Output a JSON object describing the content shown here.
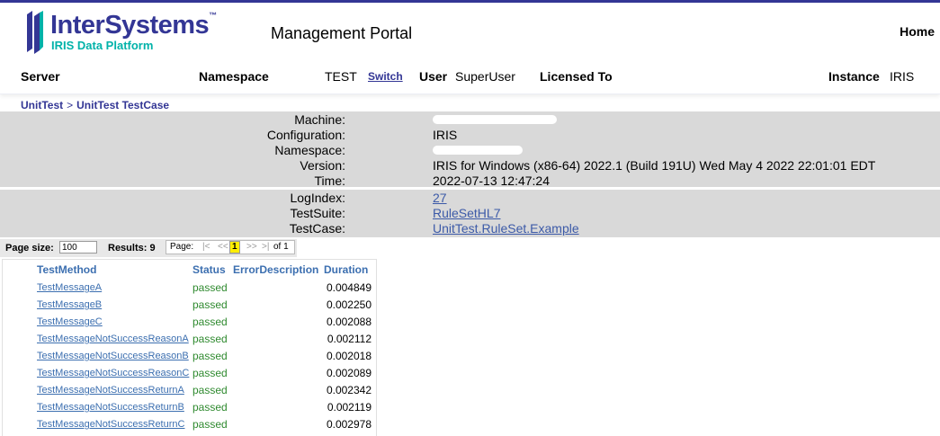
{
  "header": {
    "logo_name": "InterSystems",
    "logo_tm": "™",
    "logo_sub": "IRIS Data Platform",
    "title": "Management Portal",
    "home": "Home"
  },
  "info": {
    "server_label": "Server",
    "namespace_label": "Namespace",
    "namespace_value": "TEST",
    "switch_label": "Switch",
    "user_label": "User",
    "user_value": "SuperUser",
    "licensed_label": "Licensed To",
    "instance_label": "Instance",
    "instance_value": "IRIS"
  },
  "breadcrumb": {
    "items": [
      "UnitTest",
      "UnitTest TestCase"
    ],
    "separator": ">"
  },
  "details": {
    "machine_label": "Machine:",
    "configuration_label": "Configuration:",
    "configuration_value": "IRIS",
    "namespace_label": "Namespace:",
    "version_label": "Version:",
    "version_value": "IRIS for Windows (x86-64) 2022.1 (Build 191U) Wed May 4 2022 22:01:01 EDT",
    "time_label": "Time:",
    "time_value": "2022-07-13 12:47:24",
    "logindex_label": "LogIndex:",
    "logindex_value": "27",
    "testsuite_label": "TestSuite:",
    "testsuite_value": "RuleSetHL7",
    "testcase_label": "TestCase:",
    "testcase_value": "UnitTest.RuleSet.Example"
  },
  "table_nav": {
    "page_size_label": "Page size:",
    "page_size_value": "100",
    "results_label": "Results: 9",
    "page_label": "Page:",
    "first": "|<",
    "prev": "<<",
    "current_page": "1",
    "next": ">>",
    "last": ">|",
    "of_label": "of 1"
  },
  "table": {
    "columns": [
      "TestMethod",
      "Status",
      "ErrorDescription",
      "Duration"
    ],
    "rows": [
      {
        "method": "TestMessageA",
        "status": "passed",
        "error": "",
        "duration": "0.004849"
      },
      {
        "method": "TestMessageB",
        "status": "passed",
        "error": "",
        "duration": "0.002250"
      },
      {
        "method": "TestMessageC",
        "status": "passed",
        "error": "",
        "duration": "0.002088"
      },
      {
        "method": "TestMessageNotSuccessReasonA",
        "status": "passed",
        "error": "",
        "duration": "0.002112"
      },
      {
        "method": "TestMessageNotSuccessReasonB",
        "status": "passed",
        "error": "",
        "duration": "0.002018"
      },
      {
        "method": "TestMessageNotSuccessReasonC",
        "status": "passed",
        "error": "",
        "duration": "0.002089"
      },
      {
        "method": "TestMessageNotSuccessReturnA",
        "status": "passed",
        "error": "",
        "duration": "0.002342"
      },
      {
        "method": "TestMessageNotSuccessReturnB",
        "status": "passed",
        "error": "",
        "duration": "0.002119"
      },
      {
        "method": "TestMessageNotSuccessReturnC",
        "status": "passed",
        "error": "",
        "duration": "0.002978"
      }
    ]
  },
  "colors": {
    "brand": "#333695",
    "accent": "#00b2a9",
    "link": "#3c6fb0",
    "passed": "#2f8a2f",
    "panel": "#d9d9d9",
    "current_page": "#ffee00"
  }
}
